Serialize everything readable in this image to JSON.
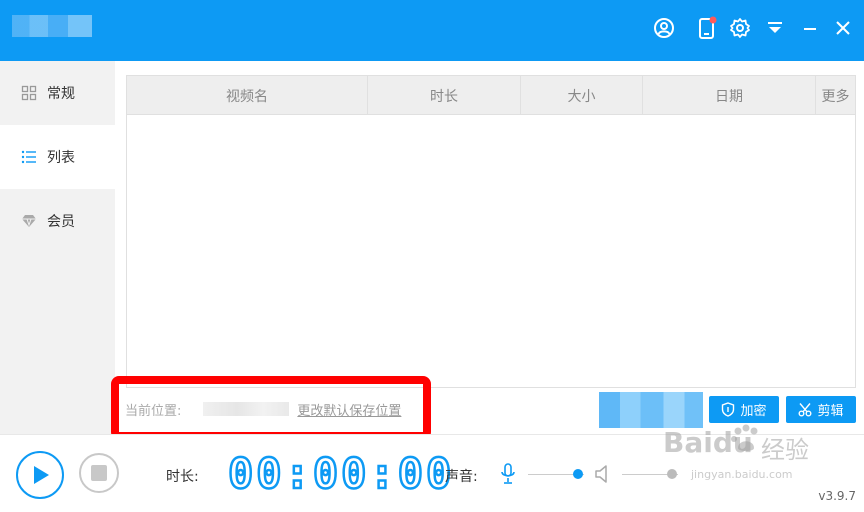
{
  "app": {
    "title_blurred": true
  },
  "titlebar": {
    "icons": [
      "user-icon",
      "phone-icon",
      "gear-icon",
      "dropdown-icon",
      "minimize-icon",
      "close-icon"
    ],
    "accent_color": "#0d9af4",
    "badge_color": "#ff5a5a"
  },
  "sidebar": {
    "items": [
      {
        "label": "常规",
        "icon": "grid-icon",
        "active": false
      },
      {
        "label": "列表",
        "icon": "list-icon",
        "active": true
      },
      {
        "label": "会员",
        "icon": "diamond-icon",
        "active": false
      }
    ]
  },
  "table": {
    "columns": [
      "视频名",
      "时长",
      "大小",
      "日期",
      "更多"
    ],
    "rows": []
  },
  "location": {
    "label": "当前位置:",
    "change_link": "更改默认保存位置"
  },
  "actions": {
    "encrypt_label": "加密",
    "cut_label": "剪辑"
  },
  "player": {
    "duration_label": "时长:",
    "timer": "00:00:00",
    "sound_label": "声音:",
    "mic_level": 0.9,
    "speaker_level": 0.9
  },
  "version": "v3.9.7",
  "watermark": {
    "brand": "Baidu",
    "brand_cn": "经验",
    "url": "jingyan.baidu.com"
  }
}
